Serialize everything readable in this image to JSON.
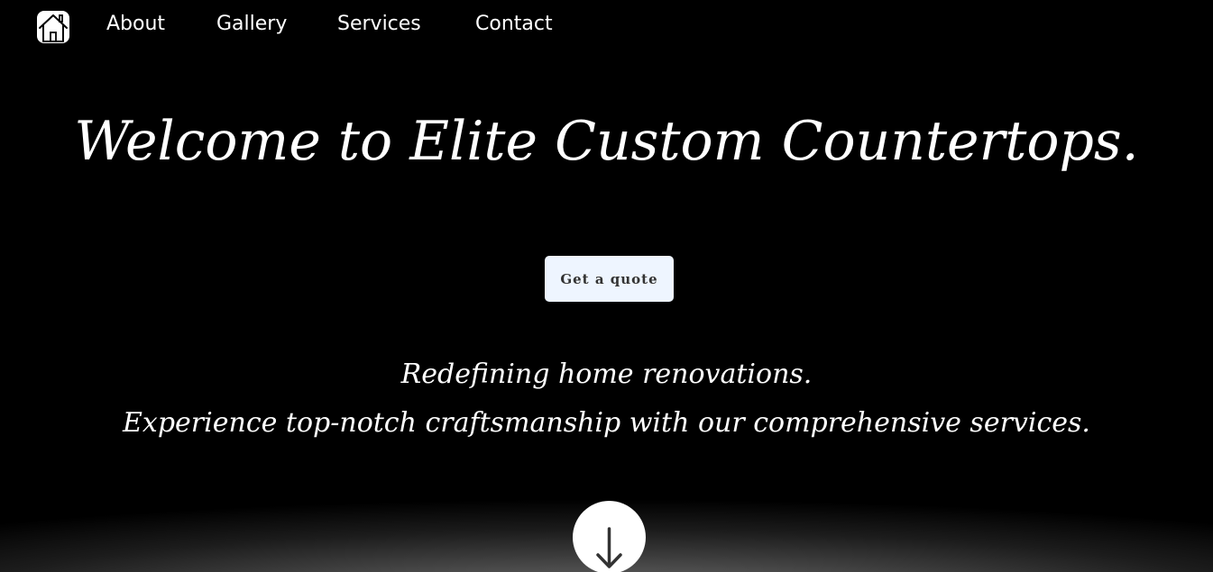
{
  "nav": {
    "home_icon": "home-icon",
    "links": [
      {
        "label": "About"
      },
      {
        "label": "Gallery"
      },
      {
        "label": "Services"
      },
      {
        "label": "Contact"
      }
    ]
  },
  "hero": {
    "title": "Welcome to Elite Custom Countertops.",
    "cta_label": "Get a quote",
    "tagline_1": "Redefining home renovations.",
    "tagline_2": "Experience top-notch craftsmanship with our comprehensive services.",
    "scroll_icon": "arrow-down-icon"
  },
  "colors": {
    "background": "#000000",
    "text": "#ffffff",
    "button_bg": "#eef5ff",
    "button_text": "#333333"
  }
}
